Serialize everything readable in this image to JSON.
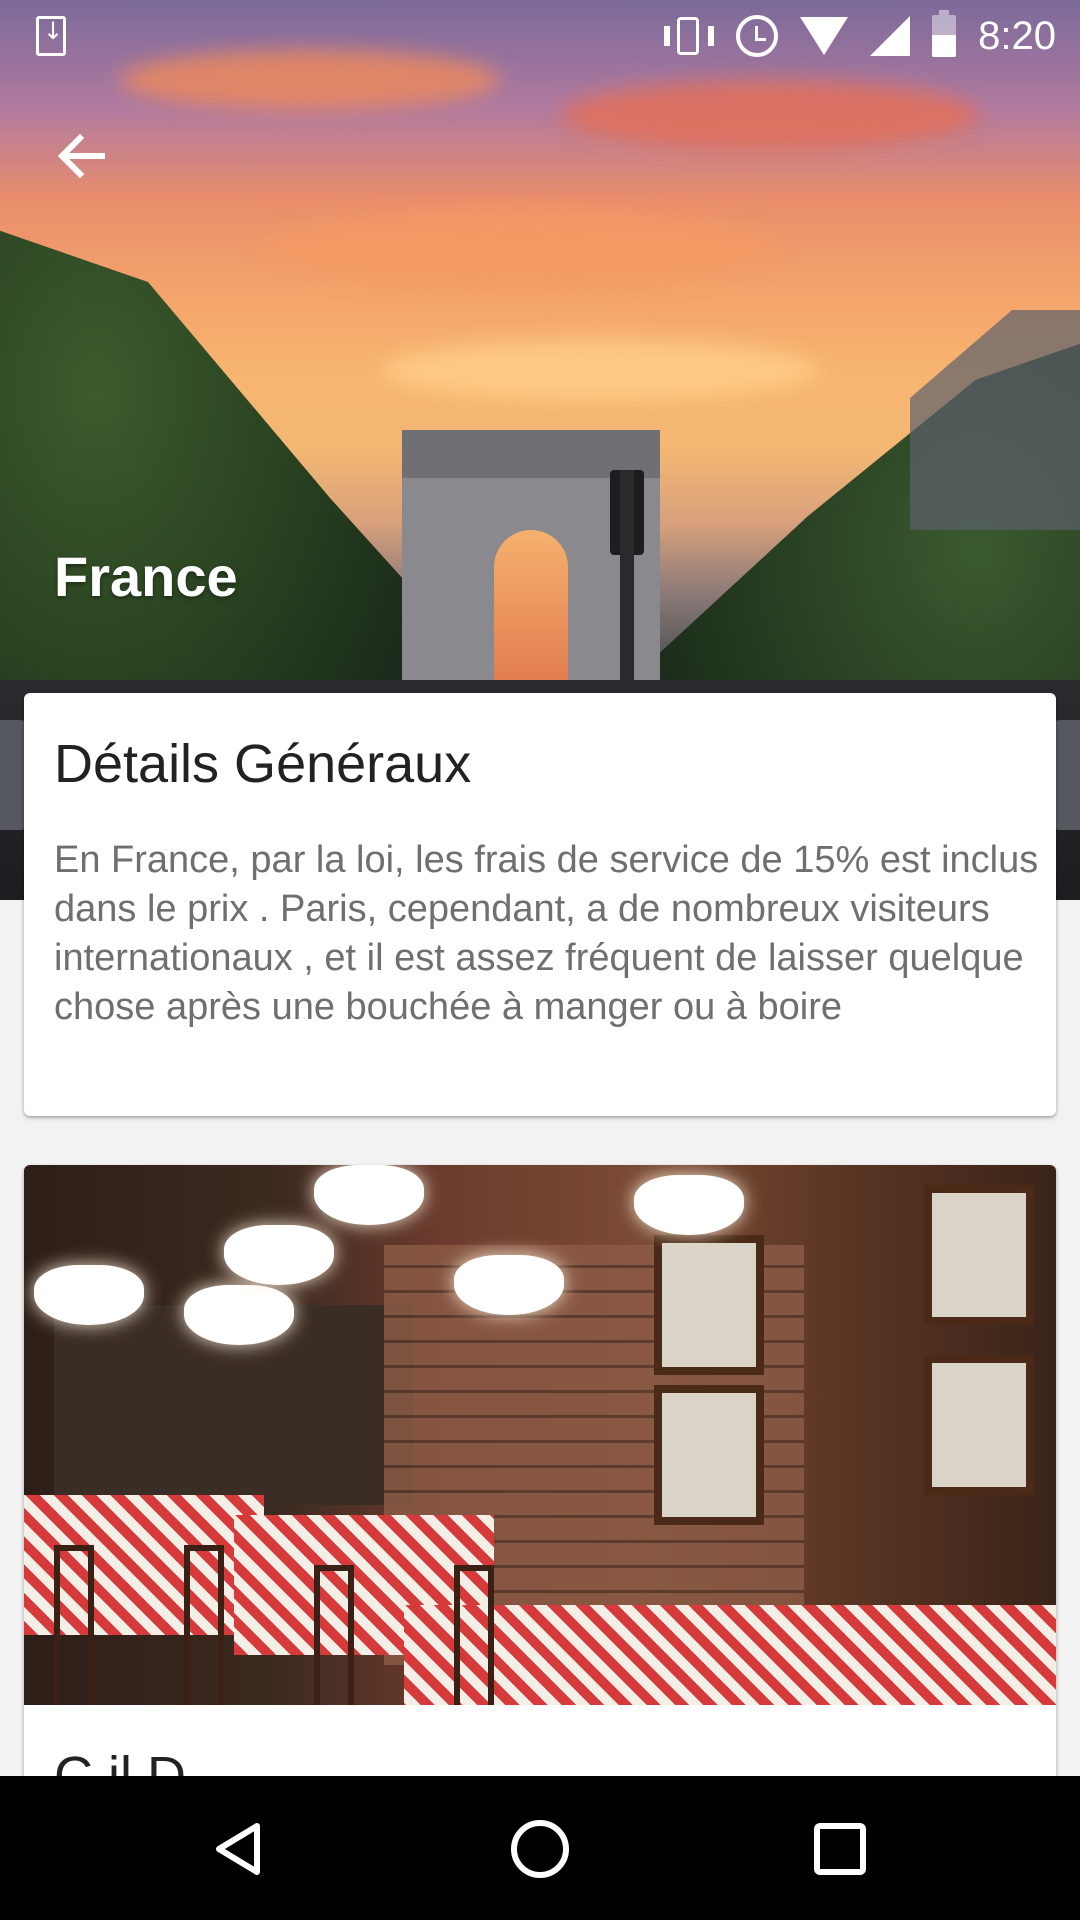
{
  "status_bar": {
    "time": "8:20",
    "icons": [
      "download-icon",
      "vibrate-icon",
      "alarm-icon",
      "wifi-icon",
      "signal-icon",
      "battery-icon"
    ]
  },
  "header": {
    "back_icon": "arrow-back-icon",
    "title": "France"
  },
  "general_details": {
    "title": "Détails Généraux",
    "body": "En France, par la loi, les frais de service de 15% est inclus dans le prix . Paris, cependant, a de nombreux visiteurs internationaux , et il est assez fréquent de laisser quelque chose après une bouchée à manger ou à boire"
  },
  "second_card": {
    "image": "restaurant-photo",
    "title_peek": "C    il    D"
  },
  "nav_bar": {
    "back": "nav-back-icon",
    "home": "nav-home-icon",
    "recents": "nav-recents-icon"
  },
  "colors": {
    "nav_bg": "#000000",
    "card_bg": "#ffffff",
    "body_text": "#6f6f6f",
    "title_text": "#222222"
  }
}
